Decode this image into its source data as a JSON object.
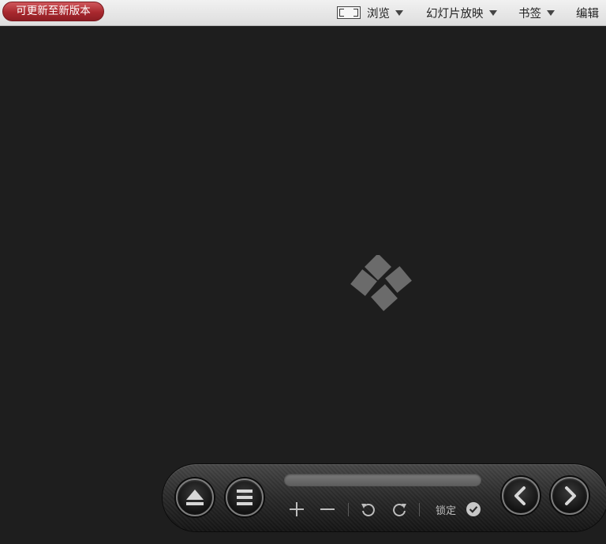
{
  "topbar": {
    "update_label": "可更新至新版本",
    "browse_label": "浏览",
    "slideshow_label": "幻灯片放映",
    "bookmark_label": "书签",
    "edit_label": "编辑"
  },
  "controls": {
    "lock_label": "锁定",
    "progress": 0
  },
  "colors": {
    "background": "#1e1e1e",
    "update_button": "#a8282e",
    "logo": "#6b6b6b",
    "toolbar": "#2a2a2a"
  },
  "icons": {
    "fullscreen": "fullscreen-icon",
    "eject": "eject-icon",
    "menu": "menu-icon",
    "zoom_in": "plus-icon",
    "zoom_out": "minus-icon",
    "rotate_left": "rotate-left-icon",
    "rotate_right": "rotate-right-icon",
    "lock": "check-circle-icon",
    "prev": "chevron-left-icon",
    "next": "chevron-right-icon",
    "logo": "app-logo-icon"
  }
}
